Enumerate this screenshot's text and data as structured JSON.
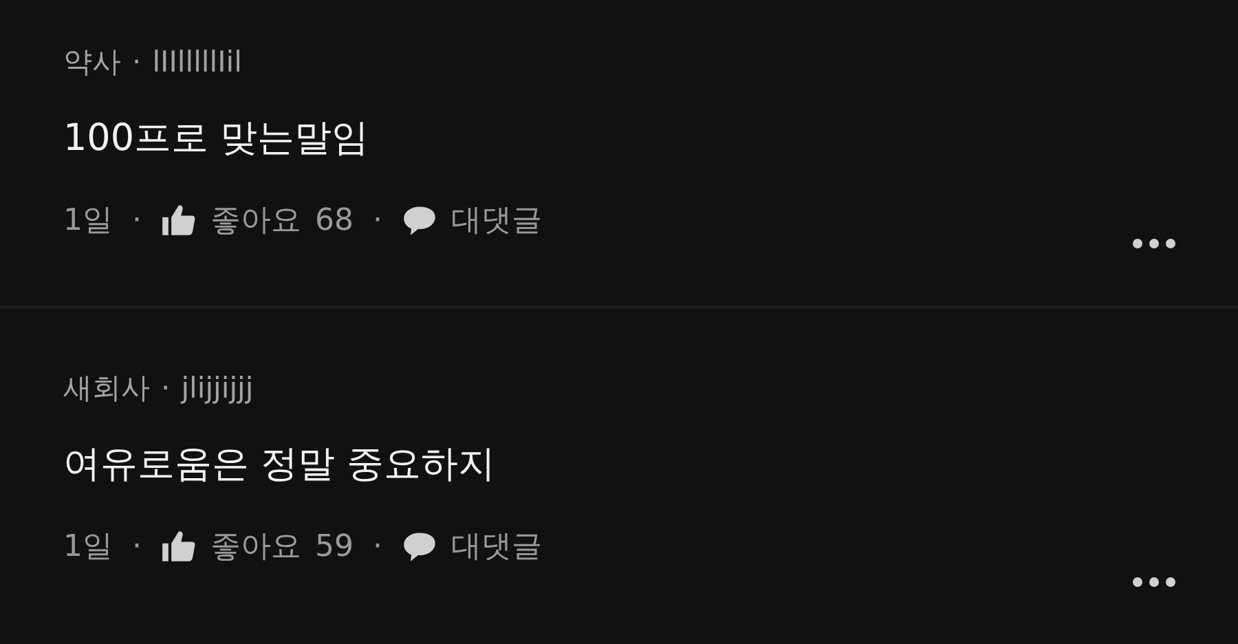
{
  "comments": [
    {
      "author": "약사",
      "separator": "·",
      "handle": "lIIlllllIil",
      "text": "100프로 맞는말임",
      "time": "1일",
      "dot_1": "·",
      "likes_label": "좋아요",
      "likes": "68",
      "dot_2": "·",
      "reply": "대댓글"
    },
    {
      "author": "새회사",
      "separator": "·",
      "handle": "jlijjijjj",
      "text": "여유로움은 정말 중요하지",
      "time": "1일",
      "dot_1": "·",
      "likes_label": "좋아요",
      "likes": "59",
      "dot_2": "·",
      "reply": "대댓글"
    }
  ]
}
